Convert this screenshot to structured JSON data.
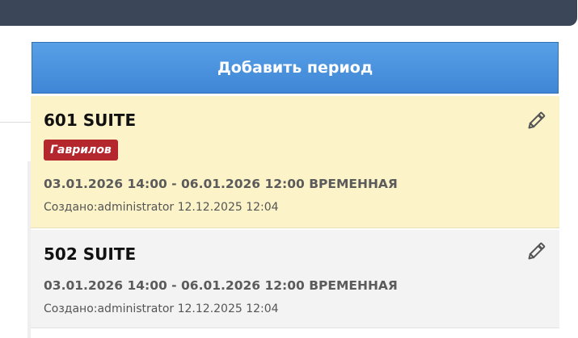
{
  "toolbar": {
    "add_period_label": "Добавить период"
  },
  "bookings": [
    {
      "room": "601 SUITE",
      "guest": "Гаврилов",
      "period": "03.01.2026 14:00 - 06.01.2026 12:00 ВРЕМЕННАЯ",
      "created": "Создано:administrator 12.12.2025 12:04"
    },
    {
      "room": "502 SUITE",
      "period": "03.01.2026 14:00 - 06.01.2026 12:00 ВРЕМЕННАЯ",
      "created": "Создано:administrator 12.12.2025 12:04"
    }
  ],
  "icons": {
    "edit": "pencil-icon"
  },
  "colors": {
    "topbar": "#3b4759",
    "add_button": "#4a90e2",
    "highlight_card": "#fcf3c8",
    "guest_badge": "#b3272d",
    "card_bg": "#f3f3f3"
  }
}
